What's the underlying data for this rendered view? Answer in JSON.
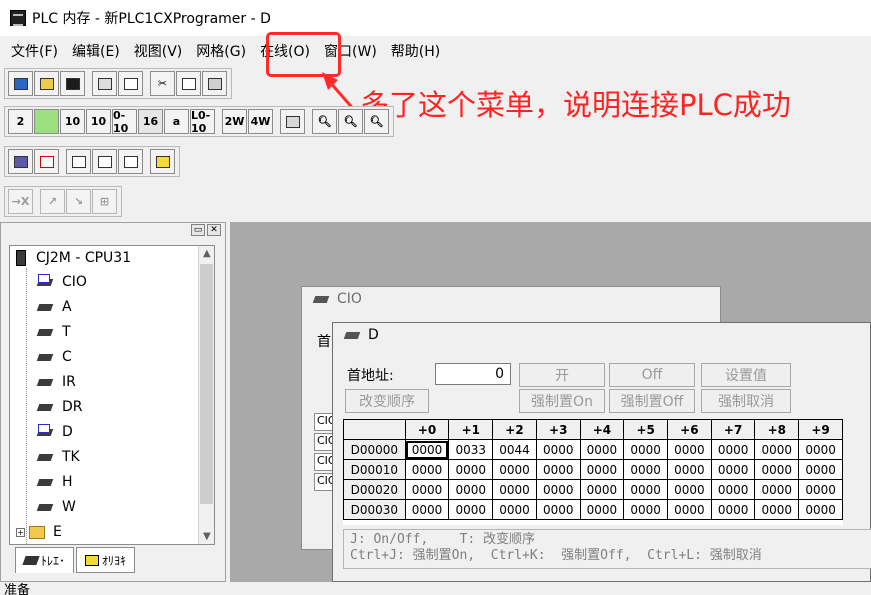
{
  "window": {
    "title": "PLC 内存 - 新PLC1CXProgramer - D"
  },
  "menu": {
    "items": [
      "文件(F)",
      "编辑(E)",
      "视图(V)",
      "网格(G)",
      "在线(O)",
      "窗口(W)",
      "帮助(H)"
    ]
  },
  "annotation": {
    "text": "多了这个菜单，说明连接PLC成功",
    "color": "#ff2323"
  },
  "toolbar2": {
    "labels": [
      "2",
      "",
      "10",
      "10",
      "0-10",
      "16",
      "a",
      "L0-10",
      "2W",
      "4W",
      "",
      "",
      "",
      ""
    ]
  },
  "tree": {
    "root": "CJ2M - CPU31",
    "nodes": [
      "CIO",
      "A",
      "T",
      "C",
      "IR",
      "DR",
      "D",
      "TK",
      "H",
      "W",
      "E"
    ],
    "tabs": [
      "ﾄﾚｴ･",
      "ｵﾘﾖｷ"
    ]
  },
  "cio_window": {
    "title": "CIO",
    "first_label": "首",
    "rows": [
      "CIO",
      "CIO",
      "CIO",
      "CIO"
    ]
  },
  "d_window": {
    "title": "D",
    "address_label": "首地址:",
    "address_value": "0",
    "buttons": {
      "on": "开",
      "off": "Off",
      "set_value": "设置值",
      "change_order": "改变顺序",
      "force_on": "强制置On",
      "force_off": "强制置Off",
      "force_cancel": "强制取消"
    },
    "columns": [
      "+0",
      "+1",
      "+2",
      "+3",
      "+4",
      "+5",
      "+6",
      "+7",
      "+8",
      "+9"
    ],
    "rows": [
      {
        "addr": "D00000",
        "values": [
          "0000",
          "0033",
          "0044",
          "0000",
          "0000",
          "0000",
          "0000",
          "0000",
          "0000",
          "0000"
        ]
      },
      {
        "addr": "D00010",
        "values": [
          "0000",
          "0000",
          "0000",
          "0000",
          "0000",
          "0000",
          "0000",
          "0000",
          "0000",
          "0000"
        ]
      },
      {
        "addr": "D00020",
        "values": [
          "0000",
          "0000",
          "0000",
          "0000",
          "0000",
          "0000",
          "0000",
          "0000",
          "0000",
          "0000"
        ]
      },
      {
        "addr": "D00030",
        "values": [
          "0000",
          "0000",
          "0000",
          "0000",
          "0000",
          "0000",
          "0000",
          "0000",
          "0000",
          "0000"
        ]
      }
    ],
    "help_line1": "J: On/Off,    T: 改变顺序",
    "help_line2": "Ctrl+J: 强制置On,  Ctrl+K:  强制置Off,  Ctrl+L: 强制取消"
  },
  "status": {
    "text": "准备"
  }
}
